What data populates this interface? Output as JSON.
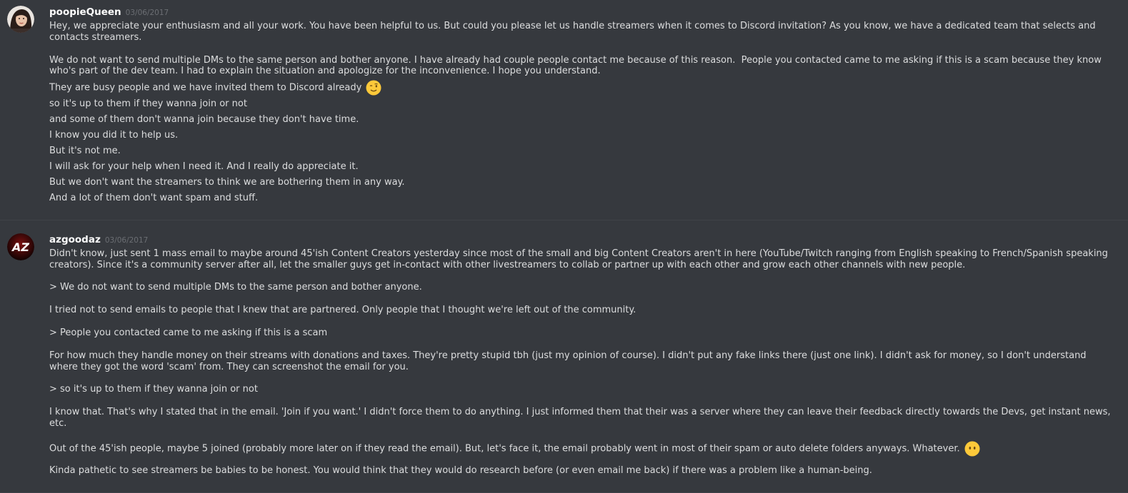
{
  "messages": [
    {
      "username": "poopieQueen",
      "timestamp": "03/06/2017",
      "avatar": "avatar-photo",
      "paragraphs": [
        "Hey, we appreciate your enthusiasm and all your work. You have been helpful to us. But could you please let us handle streamers when it comes to Discord invitation? As you know, we have a dedicated team that selects and contacts streamers.",
        "We do not want to send multiple DMs to the same person and bother anyone. I have already had couple people contact me because of this reason.  People you contacted came to me asking if this is a scam because they know who's part of the dev team. I had to explain the situation and apologize for the inconvenience. I hope you understand.",
        "They are busy people and we have invited them to Discord already",
        "so it's up to them if they wanna join or not",
        "and some of them don't wanna join because they don't have time.",
        "I know you did it to help us.",
        "But it's not me.",
        "I will ask for your help when I need it. And I really do appreciate it.",
        "But we don't want the streamers to think we are bothering them in any way.",
        "And a lot of them don't want spam and stuff."
      ],
      "emoji": "winking-face-emoji"
    },
    {
      "username": "azgoodaz",
      "timestamp": "03/06/2017",
      "avatar_text": "AZ",
      "paragraphs": [
        "Didn't know, just sent 1 mass email to maybe around 45'ish Content Creators yesterday since most of the small and big Content Creators aren't in here (YouTube/Twitch ranging from English speaking to French/Spanish speaking creators). Since it's a community server after all, let the smaller guys get in-contact with other livestreamers to collab or partner up with each other and grow each other channels with new people.",
        "> We do not want to send multiple DMs to the same person and bother anyone.",
        "I tried not to send emails to people that I knew that are partnered. Only people that I thought we're left out of the community.",
        "> People you contacted came to me asking if this is a scam",
        "For how much they handle money on their streams with donations and taxes. They're pretty stupid tbh (just my opinion of course). I didn't put any fake links there (just one link). I didn't ask for money, so I don't understand where they got the word 'scam' from. They can screenshot the email for you.",
        "> so it's up to them if they wanna join or not",
        "I know that. That's why I stated that in the email. 'Join if you want.' I didn't force them to do anything. I just informed them that their was a server where they can leave their feedback directly towards the Devs, get instant news, etc.",
        "Out of the 45'ish people, maybe 5 joined (probably more later on if they read the email). But, let's face it, the email probably went in most of their spam or auto delete folders anyways. Whatever.",
        "Kinda pathetic to see streamers be babies to be honest. You would think that they would do research before (or even email me back) if there was a problem like a human-being."
      ],
      "emoji": "face-without-mouth-emoji"
    }
  ]
}
